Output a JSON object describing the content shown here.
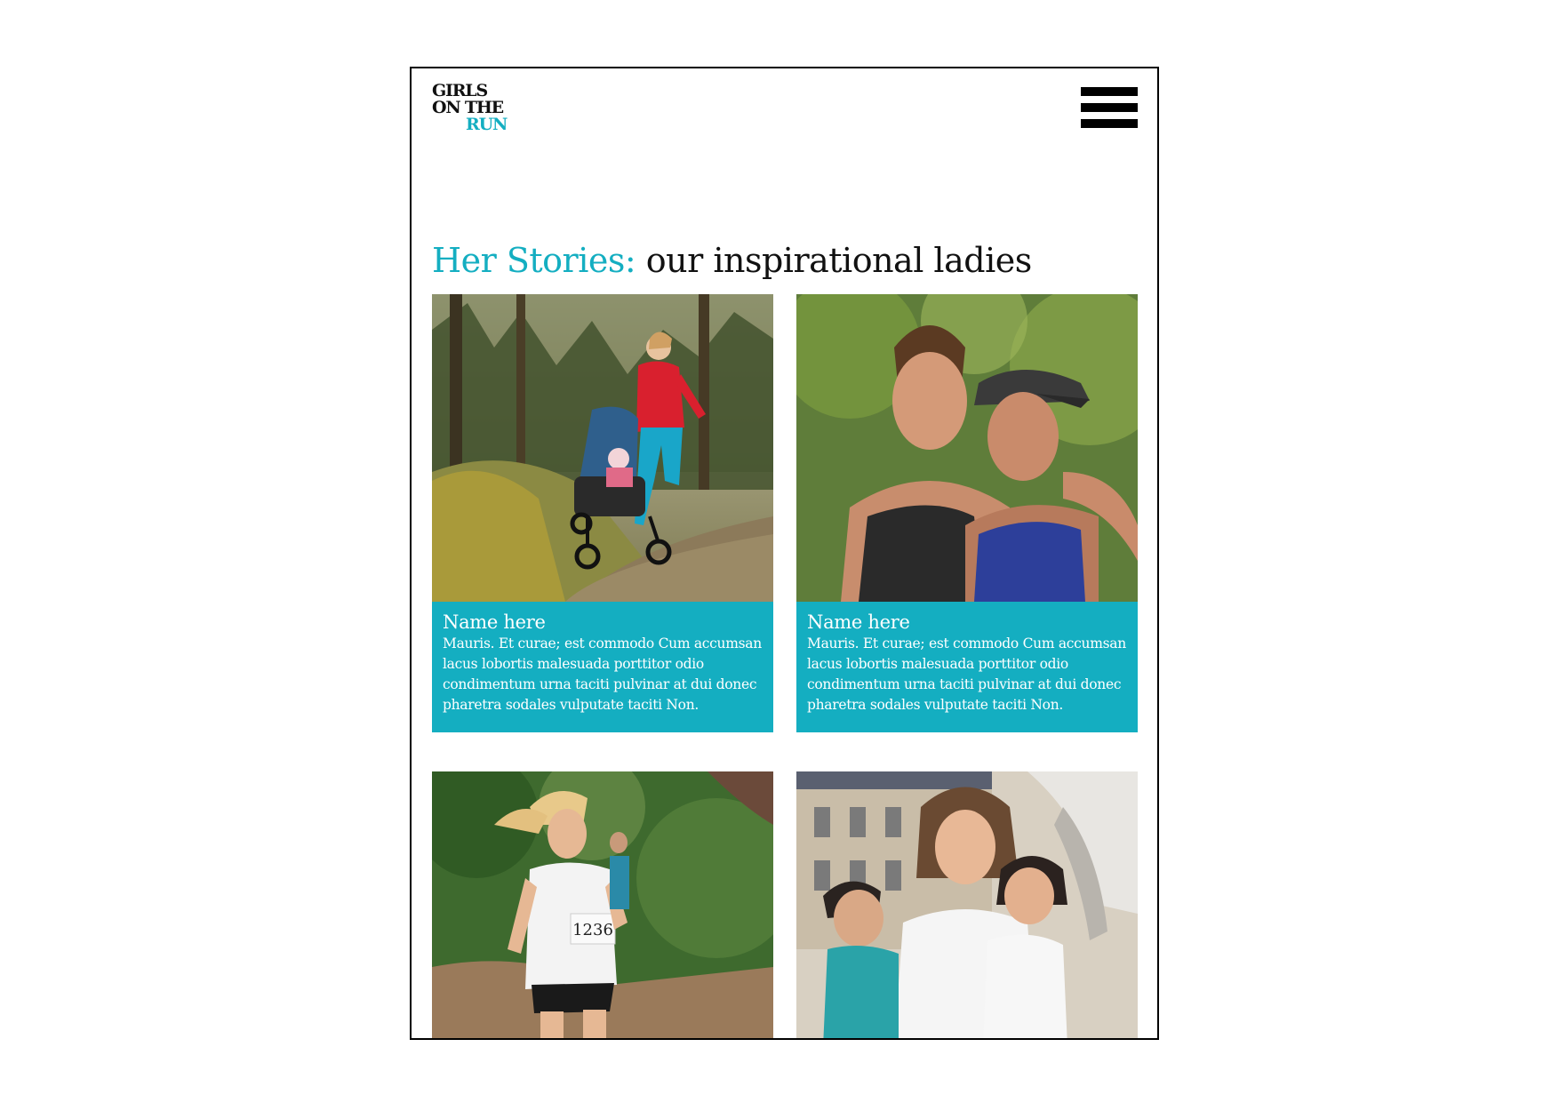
{
  "header": {
    "logo_line1": "GIRLS",
    "logo_line2": "ON THE",
    "logo_line3": "RUN",
    "menu_icon": "hamburger-menu-icon"
  },
  "page": {
    "heading_accent": "Her Stories:",
    "heading_rest": " our inspirational ladies"
  },
  "colors": {
    "accent": "#14aec1",
    "text": "#111111",
    "background": "#ffffff"
  },
  "stories": [
    {
      "name": "Name here",
      "text": "Mauris. Et curae; est commodo Cum accumsan lacus lobortis malesuada porttitor odio condimentum urna taciti pulvinar at dui donec pharetra sodales vulputate taciti Non.",
      "photo": "woman-running-with-stroller-photo"
    },
    {
      "name": "Name here",
      "text": "Mauris. Et curae; est commodo Cum accumsan lacus lobortis malesuada porttitor odio condimentum urna taciti pulvinar at dui donec pharetra sodales vulputate taciti Non.",
      "photo": "two-women-embracing-photo"
    },
    {
      "photo": "girl-running-race-photo",
      "bib_number": "1236"
    },
    {
      "photo": "mother-with-two-daughters-photo"
    }
  ]
}
